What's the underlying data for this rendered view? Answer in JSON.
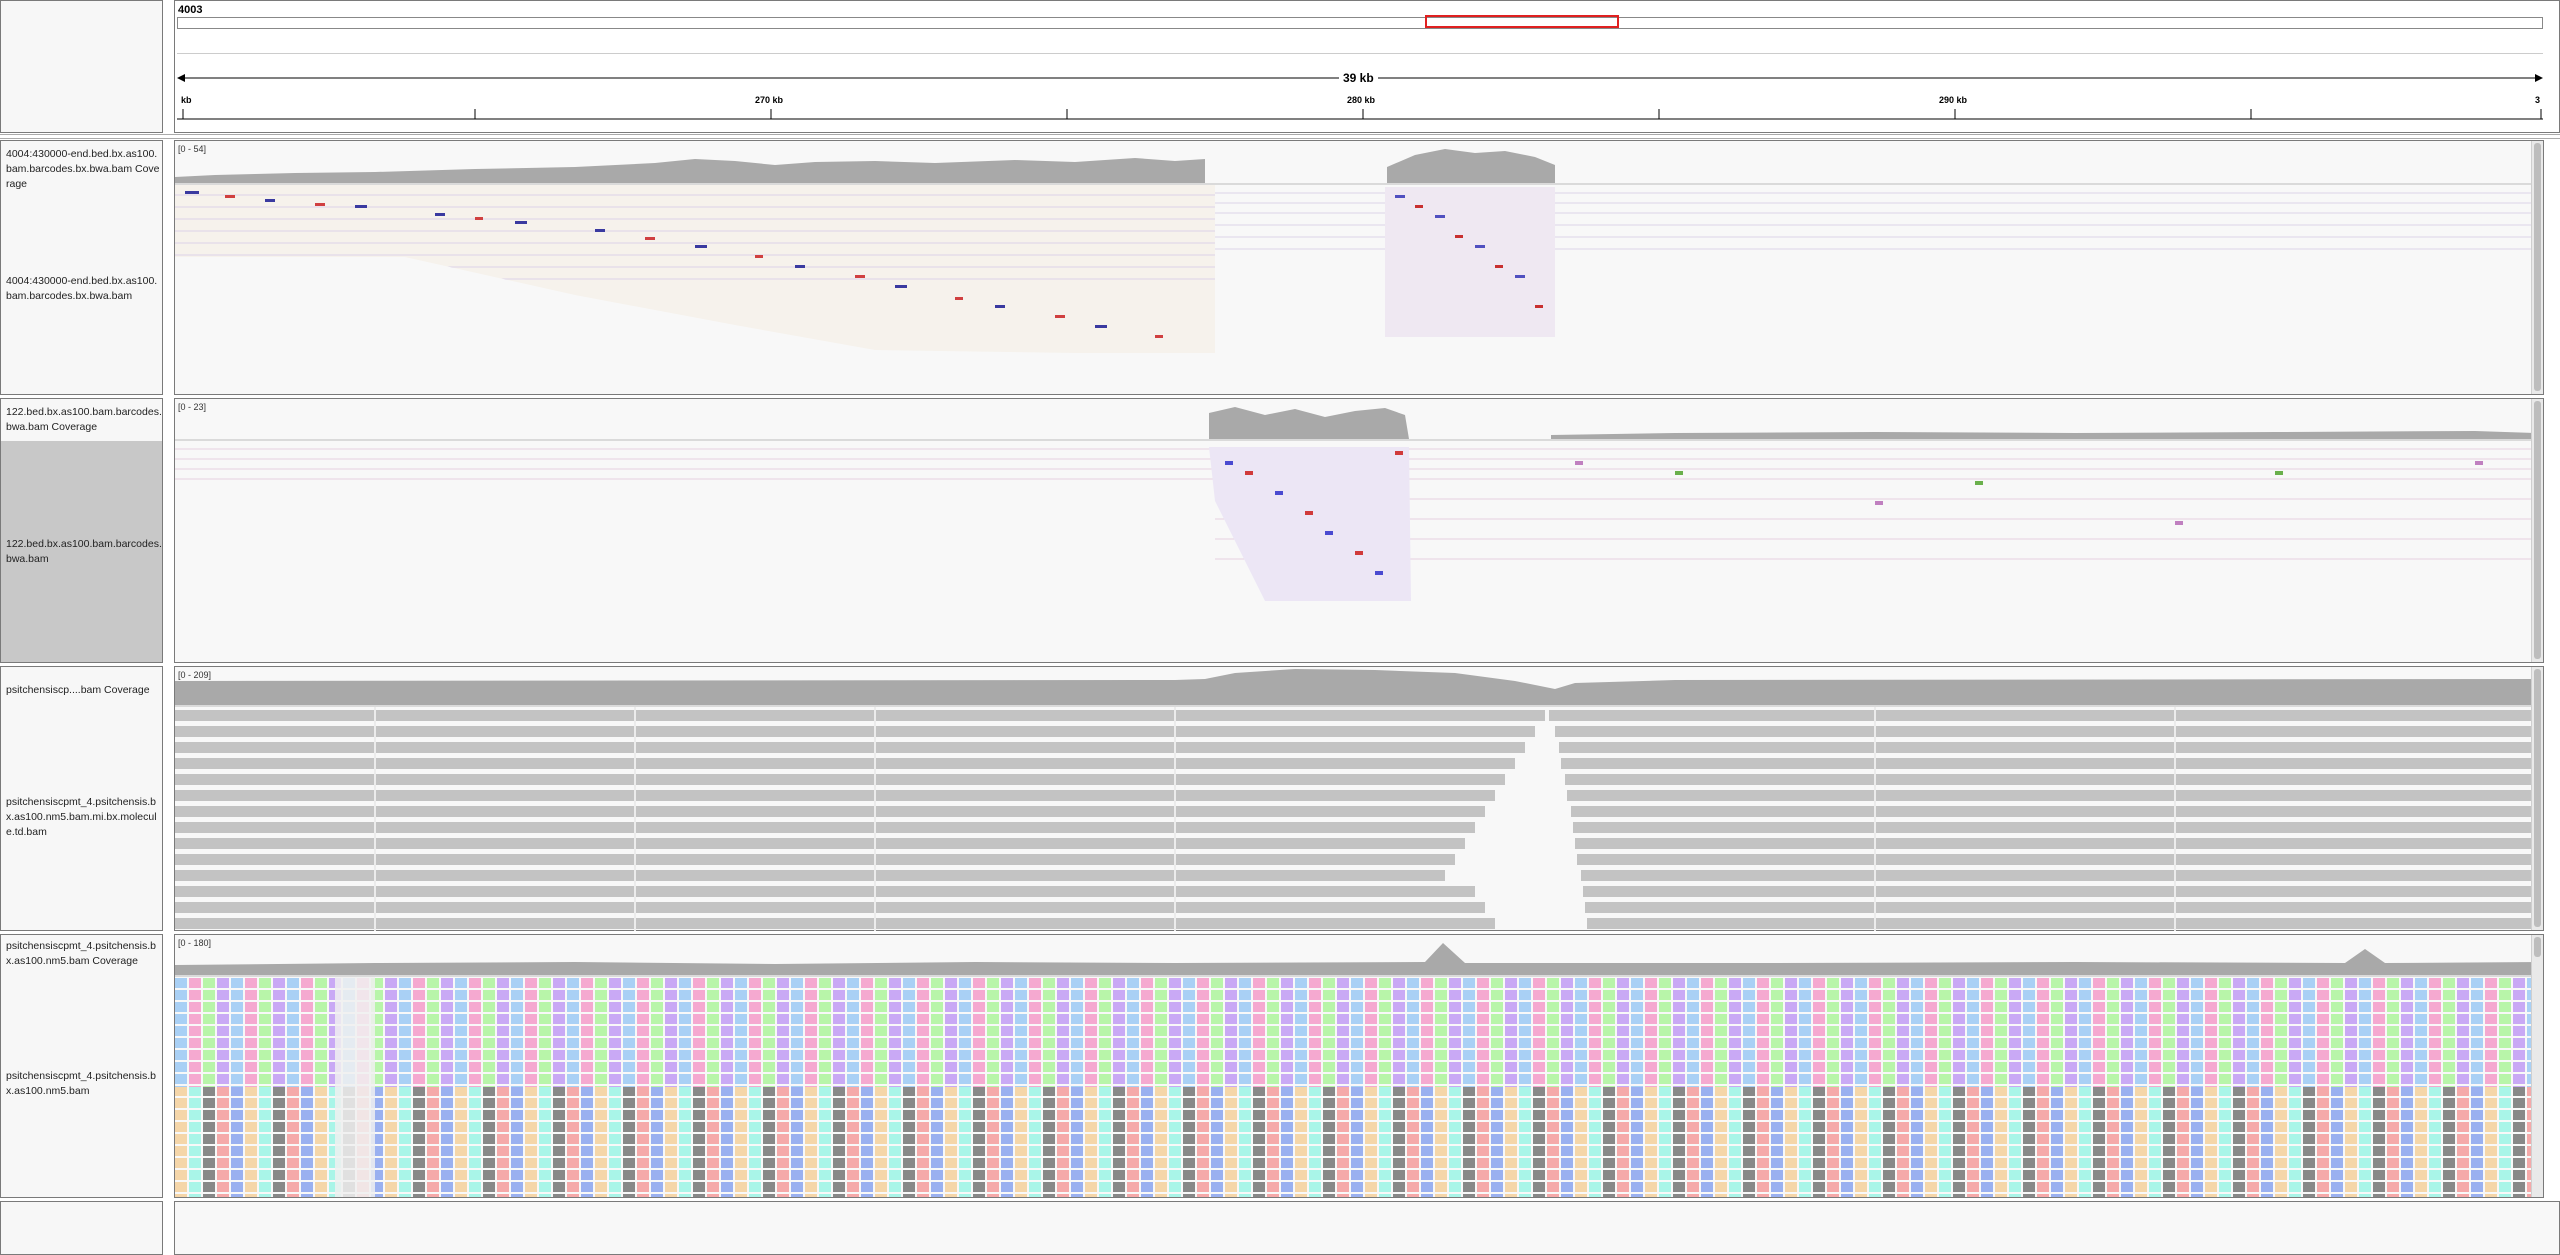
{
  "header": {
    "chromosome": "4003",
    "span_label": "39 kb",
    "ticks": [
      "kb",
      "270 kb",
      "280 kb",
      "290 kb",
      "3"
    ]
  },
  "tracks": [
    {
      "coverage_name": "4004:430000-end.bed.bx.as100.bam.barcodes.bx.bwa.bam Coverage",
      "alignment_name": "4004:430000-end.bed.bx.as100.bam.barcodes.bx.bwa.bam",
      "range": "[0 - 54]"
    },
    {
      "coverage_name": "122.bed.bx.as100.bam.barcodes.bwa.bam Coverage",
      "alignment_name": "122.bed.bx.as100.bam.barcodes.bwa.bam",
      "range": "[0 - 23]"
    },
    {
      "coverage_name": "psitchensiscp....bam Coverage",
      "alignment_name": "psitchensiscpmt_4.psitchensis.bx.as100.nm5.bam.mi.bx.molecule.td.bam",
      "range": "[0 - 209]"
    },
    {
      "coverage_name": "psitchensiscpmt_4.psitchensis.bx.as100.nm5.bam Coverage",
      "alignment_name": "psitchensiscpmt_4.psitchensis.bx.as100.nm5.bam",
      "range": "[0 - 180]"
    }
  ],
  "colors": {
    "coverage_gray": "#a9a9a9",
    "read_gray": "#c3c3c3",
    "region_box": "#e02020",
    "panel_border": "#7a7a7a",
    "selected_name_bg": "#c8c8c8"
  }
}
